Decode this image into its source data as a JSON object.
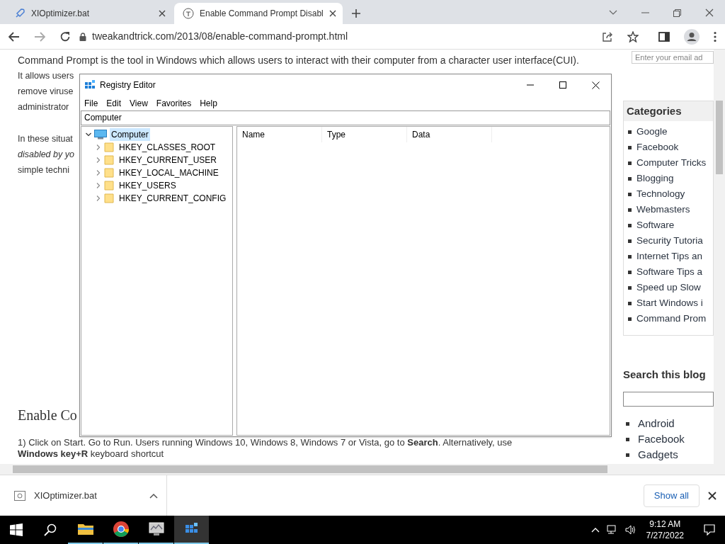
{
  "browser": {
    "tabs": [
      {
        "title": "XIOptimizer.bat",
        "selected": false
      },
      {
        "title": "Enable Command Prompt Disabl",
        "selected": true
      }
    ],
    "address": "tweakandtrick.com/2013/08/enable-command-prompt.html"
  },
  "article": {
    "intro": "Command Prompt is the tool in Windows which allows users to interact with their computer from a character user interface(CUI).",
    "lines": [
      {
        "text": "It allows users",
        "kind": "normal"
      },
      {
        "text": "remove viruse",
        "kind": "normal"
      },
      {
        "text": "administrator",
        "kind": "normal"
      },
      {
        "text": "In these situat",
        "kind": "gap"
      },
      {
        "text": "disabled by yo",
        "kind": "italic"
      },
      {
        "text": "simple techni",
        "kind": "normal"
      }
    ],
    "heading": "Enable Co",
    "steps": [
      "1) Click on Start. Go to Run. Users running Windows 10, Windows 8, Windows 7 or Vista, go to **Search**. Alternatively, use",
      "**Windows key+R** keyboard shortcut"
    ]
  },
  "sidebar": {
    "email_placeholder": "Enter your email ad",
    "categories_title": "Categories",
    "categories": [
      "Google",
      "Facebook",
      "Computer Tricks",
      "Blogging",
      "Technology",
      "Webmasters",
      "Software",
      "Security Tutoria",
      "Internet Tips an",
      "Software Tips a",
      "Speed up Slow",
      "Start Windows i",
      "Command Prom"
    ],
    "search_title": "Search this blog",
    "links": [
      "Android",
      "Facebook",
      "Gadgets"
    ]
  },
  "registry_editor": {
    "title": "Registry Editor",
    "menu": [
      "File",
      "Edit",
      "View",
      "Favorites",
      "Help"
    ],
    "address": "Computer",
    "tree": {
      "label": "Computer",
      "expanded": true,
      "selected": true,
      "children": [
        {
          "label": "HKEY_CLASSES_ROOT",
          "selected": false
        },
        {
          "label": "HKEY_CURRENT_USER",
          "selected": false
        },
        {
          "label": "HKEY_LOCAL_MACHINE",
          "selected": false
        },
        {
          "label": "HKEY_USERS",
          "selected": false
        },
        {
          "label": "HKEY_CURRENT_CONFIG",
          "selected": false
        }
      ]
    },
    "columns": [
      "Name",
      "Type",
      "Data"
    ]
  },
  "downloads": {
    "file": "XIOptimizer.bat",
    "show_all": "Show all"
  },
  "taskbar": {
    "apps": [
      {
        "kind": "explorer",
        "active": false
      },
      {
        "kind": "chrome",
        "active": false
      },
      {
        "kind": "monitor",
        "active": false
      },
      {
        "kind": "regedit",
        "active": true
      }
    ],
    "time": "9:12 AM",
    "date": "7/27/2022"
  }
}
